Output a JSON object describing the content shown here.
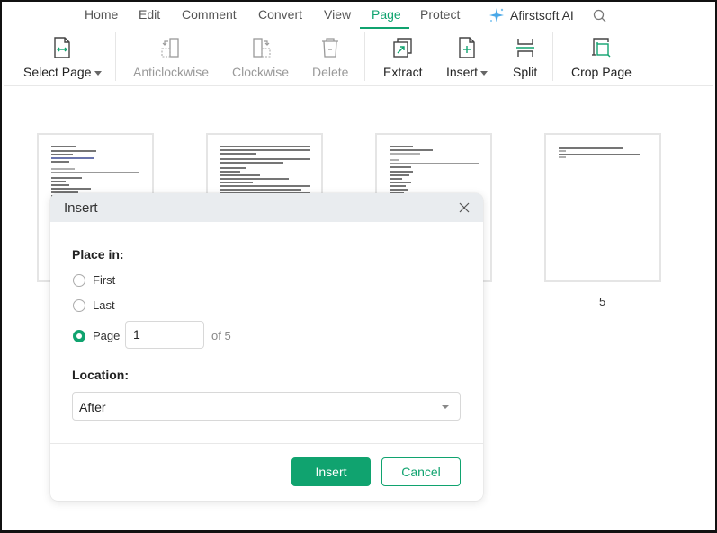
{
  "menu": {
    "tabs": [
      {
        "label": "Home"
      },
      {
        "label": "Edit"
      },
      {
        "label": "Comment"
      },
      {
        "label": "Convert"
      },
      {
        "label": "View"
      },
      {
        "label": "Page",
        "active": true
      },
      {
        "label": "Protect"
      }
    ],
    "ai_label": "Afirstsoft AI",
    "ai_icon": "sparkle-icon",
    "search_icon": "search-icon"
  },
  "toolbar": {
    "select_page": "Select Page",
    "anticlockwise": "Anticlockwise",
    "clockwise": "Clockwise",
    "delete": "Delete",
    "extract": "Extract",
    "insert": "Insert",
    "split": "Split",
    "crop_page": "Crop Page"
  },
  "thumbnails": {
    "visible_page_number": "5",
    "total_pages": 5
  },
  "dialog": {
    "title": "Insert",
    "place_in_label": "Place in:",
    "options": [
      {
        "label": "First",
        "checked": false
      },
      {
        "label": "Last",
        "checked": false
      },
      {
        "label": "Page",
        "checked": true
      }
    ],
    "page_value": "1",
    "of_label": "of 5",
    "location_label": "Location:",
    "location_value": "After",
    "insert_button": "Insert",
    "cancel_button": "Cancel"
  },
  "colors": {
    "accent": "#10a36f",
    "header_bg": "#e9ecef"
  }
}
